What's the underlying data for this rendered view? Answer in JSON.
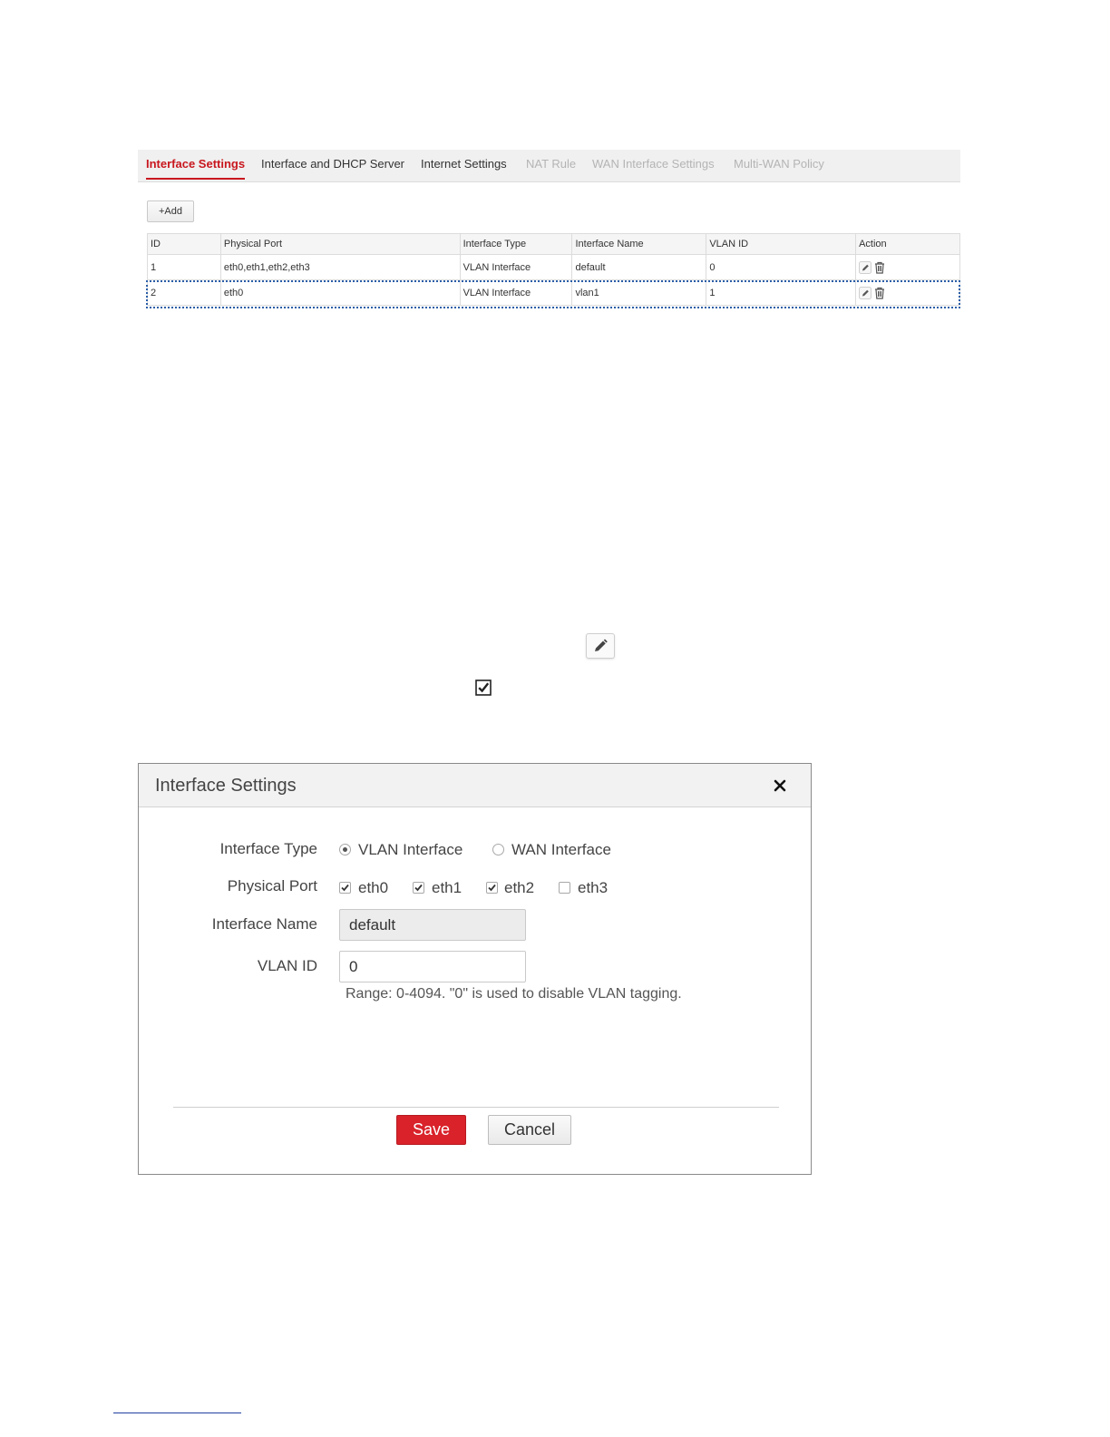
{
  "tabs": [
    {
      "label": "Interface Settings",
      "state": "active"
    },
    {
      "label": "Interface and DHCP Server",
      "state": "normal"
    },
    {
      "label": "Internet Settings",
      "state": "normal"
    },
    {
      "label": "NAT Rule",
      "state": "disabled"
    },
    {
      "label": "WAN Interface Settings",
      "state": "disabled"
    },
    {
      "label": "Multi-WAN Policy",
      "state": "disabled"
    }
  ],
  "table": {
    "add_label": "+Add",
    "columns": [
      "ID",
      "Physical Port",
      "Interface Type",
      "Interface Name",
      "VLAN ID",
      "Action"
    ],
    "rows": [
      {
        "id": "1",
        "port": "eth0,eth1,eth2,eth3",
        "type": "VLAN Interface",
        "name": "default",
        "vlan": "0"
      },
      {
        "id": "2",
        "port": "eth0",
        "type": "VLAN Interface",
        "name": "vlan1",
        "vlan": "1"
      }
    ]
  },
  "dialog": {
    "title": "Interface Settings",
    "interface_type": {
      "label": "Interface Type",
      "options": [
        {
          "label": "VLAN Interface",
          "selected": true
        },
        {
          "label": "WAN Interface",
          "selected": false
        }
      ]
    },
    "physical_port": {
      "label": "Physical Port",
      "ports": [
        {
          "label": "eth0",
          "checked": true
        },
        {
          "label": "eth1",
          "checked": true
        },
        {
          "label": "eth2",
          "checked": true
        },
        {
          "label": "eth3",
          "checked": false
        }
      ]
    },
    "interface_name": {
      "label": "Interface Name",
      "value": "default"
    },
    "vlan_id": {
      "label": "VLAN ID",
      "value": "0",
      "hint": "Range: 0-4094. \"0\" is used to disable VLAN tagging."
    },
    "save_label": "Save",
    "cancel_label": "Cancel"
  },
  "colors": {
    "accent": "#c8171e",
    "save_button": "#d9222a",
    "selection_outline": "#2a5ea8"
  }
}
